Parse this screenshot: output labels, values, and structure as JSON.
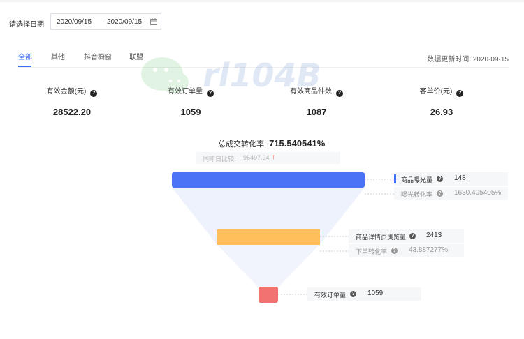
{
  "filter": {
    "label": "请选择日期",
    "start_date": "2020/09/15",
    "separator": "–",
    "end_date": "2020/09/15",
    "icon": "calendar-icon"
  },
  "tabs": [
    {
      "label": "全部",
      "active": true
    },
    {
      "label": "其他",
      "active": false
    },
    {
      "label": "抖音橱窗",
      "active": false
    },
    {
      "label": "联盟",
      "active": false
    }
  ],
  "update_time": "数据更新时间: 2020-09-15",
  "watermark": "rl104B",
  "metrics": [
    {
      "label": "有效金额(元)",
      "value": "28522.20"
    },
    {
      "label": "有效订单量",
      "value": "1059"
    },
    {
      "label": "有效商品件数",
      "value": "1087"
    },
    {
      "label": "客单价(元)",
      "value": "26.93"
    }
  ],
  "help_icon": "?",
  "conversion": {
    "label": "总成交转化率:",
    "value": "715.540541%",
    "compare_label": "同昨日比较:",
    "compare_value": "96497.94",
    "trend": "up",
    "trend_color": "#e84a3c"
  },
  "funnel": {
    "colors": {
      "stage1": "#4a74f5",
      "stage2": "#ffbf5a",
      "stage3": "#f27272",
      "body": "#eef2fd"
    },
    "stages": [
      {
        "label": "商品曝光量",
        "value": "148"
      },
      {
        "label": "曝光转化率",
        "value": "1630.405405%"
      },
      {
        "label": "商品详情页浏览量",
        "value": "2413"
      },
      {
        "label": "下单转化率",
        "value": "43.887277%"
      },
      {
        "label": "有效订单量",
        "value": "1059"
      }
    ]
  }
}
